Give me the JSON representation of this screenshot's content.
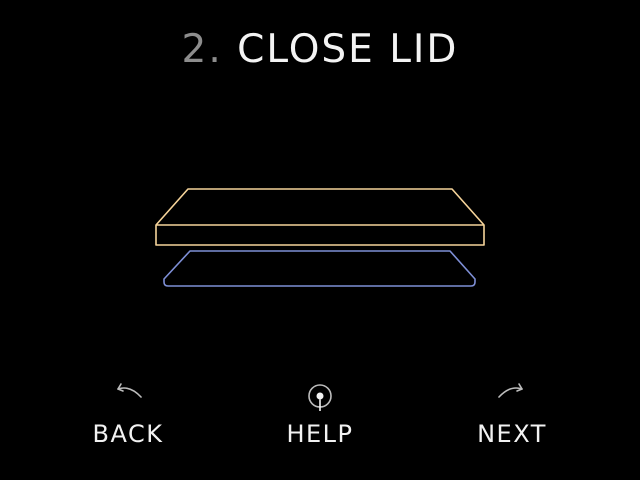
{
  "title": {
    "step": "2.",
    "label": "CLOSE LID"
  },
  "colors": {
    "background": "#000000",
    "step_number": "#8d8d8d",
    "title_text": "#f4f4f4",
    "lid_outline": "#f6d49a",
    "base_outline": "#7e8fd6",
    "nav_icon": "#bdbdbd"
  },
  "illustration": {
    "lid_icon": "lid-panel-icon",
    "base_icon": "base-tray-icon"
  },
  "nav": {
    "back": {
      "label": "BACK",
      "icon": "undo-arrow-icon"
    },
    "help": {
      "label": "HELP",
      "icon": "help-pin-icon"
    },
    "next": {
      "label": "NEXT",
      "icon": "redo-arrow-icon"
    }
  }
}
